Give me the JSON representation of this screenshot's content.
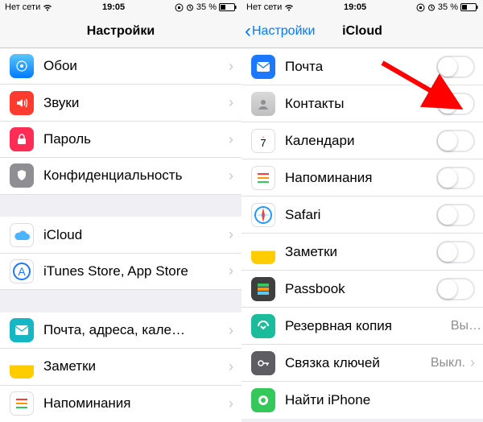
{
  "status": {
    "carrier": "Нет сети",
    "time": "19:05",
    "battery": "35 %"
  },
  "left": {
    "title": "Настройки",
    "rows": [
      {
        "label": "Обои"
      },
      {
        "label": "Звуки"
      },
      {
        "label": "Пароль"
      },
      {
        "label": "Конфиденциальность"
      }
    ],
    "group2": [
      {
        "label": "iCloud"
      },
      {
        "label": "iTunes Store, App Store"
      }
    ],
    "group3": [
      {
        "label": "Почта, адреса, кале…"
      },
      {
        "label": "Заметки"
      },
      {
        "label": "Напоминания"
      }
    ]
  },
  "right": {
    "back": "Настройки",
    "title": "iCloud",
    "rows": [
      {
        "label": "Почта",
        "toggle": true
      },
      {
        "label": "Контакты",
        "toggle": true
      },
      {
        "label": "Календари",
        "toggle": true
      },
      {
        "label": "Напоминания",
        "toggle": true
      },
      {
        "label": "Safari",
        "toggle": true
      },
      {
        "label": "Заметки",
        "toggle": true
      },
      {
        "label": "Passbook",
        "toggle": true
      },
      {
        "label": "Резервная копия",
        "value": "Вы…"
      },
      {
        "label": "Связка ключей",
        "value": "Выкл."
      },
      {
        "label": "Найти iPhone"
      }
    ]
  }
}
